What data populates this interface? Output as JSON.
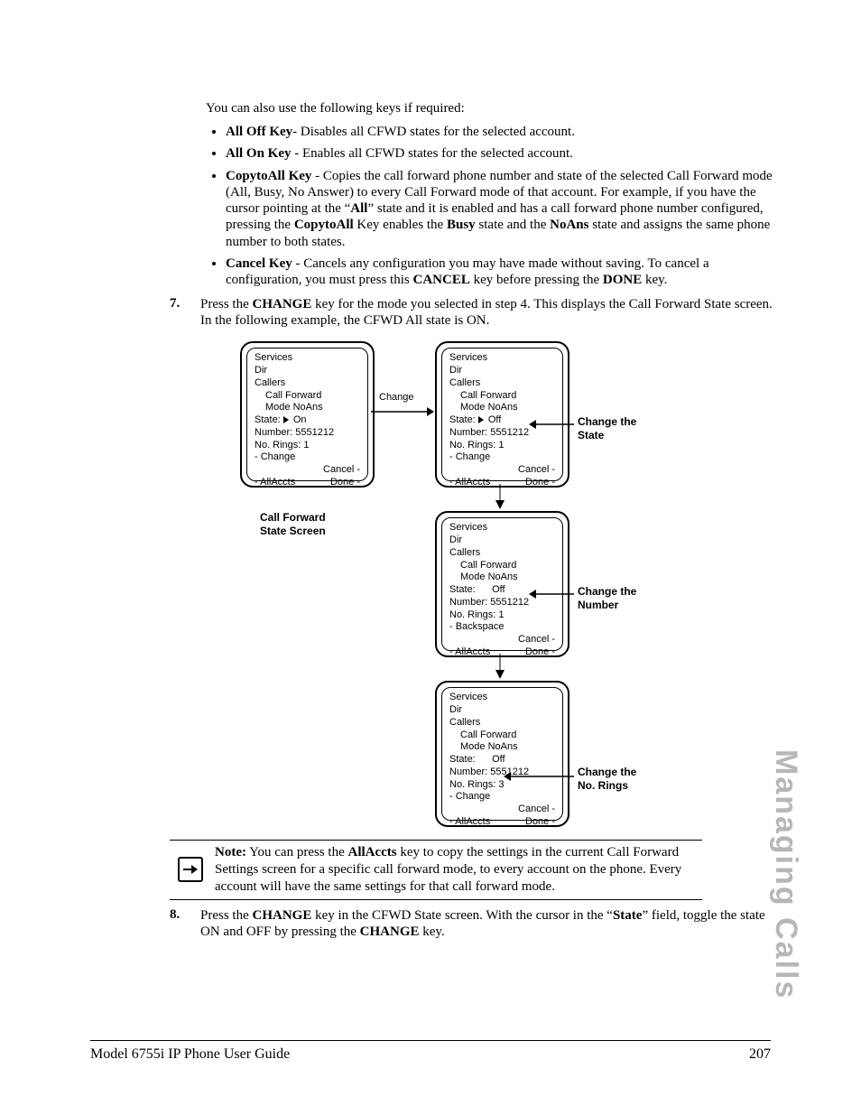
{
  "intro": "You can also use the following keys if required:",
  "bullets": {
    "b1": {
      "key": "All Off Key",
      "sep": "- ",
      "rest": "Disables all CFWD states for the selected account."
    },
    "b2": {
      "key": "All On Key",
      "sep": " - ",
      "rest": "Enables all CFWD states for the selected account."
    },
    "b3": {
      "key": "CopytoAll Key",
      "sep": " - ",
      "p1": "Copies the call forward phone number and state of the selected Call Forward mode (All, Busy, No Answer) to every Call Forward mode of that account. For example, if you have the cursor pointing at the “",
      "all": "All",
      "p2": "” state and it is enabled and has a call forward phone number configured, pressing the ",
      "cta": "CopytoAll",
      "p3": " Key enables the ",
      "busy": "Busy",
      "p4": " state and the ",
      "noans": "NoAns",
      "p5": " state and assigns the same phone number to both states."
    },
    "b4": {
      "key": "Cancel Key",
      "sep": " - ",
      "p1": "Cancels any configuration you may have made without saving. To cancel a configuration, you must press this ",
      "cancel": "CANCEL",
      "p2": " key before pressing the ",
      "done": "DONE",
      "p3": " key."
    }
  },
  "step7": {
    "num": "7.",
    "p1": "Press the ",
    "change": "CHANGE",
    "p2": " key for the mode you selected in step 4. This displays the Call Forward State screen. In the following example, the CFWD All state is ON."
  },
  "diagram": {
    "common": {
      "services": "Services",
      "dir": "Dir",
      "callers": "Callers",
      "cf": "Call Forward",
      "mode": "Mode NoAns"
    },
    "screen1": {
      "state": "State:",
      "stateVal": "On",
      "number": "Number: 5551212",
      "rings": "No. Rings: 1",
      "softL1": "- Change",
      "softR1": "Cancel -",
      "softL2": "- AllAccts",
      "softR2": "Done -"
    },
    "screen2": {
      "state": "State:",
      "stateVal": "Off",
      "number": "Number: 5551212",
      "rings": "No. Rings: 1",
      "softL1": "- Change",
      "softR1": "Cancel -",
      "softL2": "- AllAccts",
      "softR2": "Done -"
    },
    "screen3": {
      "state": "State:      Off",
      "number": "Number: 5551212",
      "rings": "No. Rings: 1",
      "softL1": "- Backspace",
      "softR1": "Cancel -",
      "softL2": "- AllAccts",
      "softR2": "Done -"
    },
    "screen4": {
      "state": "State:      Off",
      "number": "Number: 5551212",
      "rings": "No. Rings: 3",
      "softL1": "- Change",
      "softR1": "Cancel -",
      "softL2": "- AllAccts",
      "softR2": "Done -"
    },
    "labels": {
      "cfss": "Call Forward\nState Screen",
      "change": "Change",
      "chState": "Change the\nState",
      "chNumber": "Change the\nNumber",
      "chRings": "Change the\nNo. Rings"
    }
  },
  "note": {
    "label": "Note:",
    "p1": " You can press the ",
    "allaccts": "AllAccts",
    "p2": " key to copy the settings in the current Call Forward Settings screen for a specific call forward mode, to every account on the phone. Every account will have the same settings for that call forward mode."
  },
  "step8": {
    "num": "8.",
    "p1": "Press the ",
    "change": "CHANGE",
    "p2": " key in the CFWD State screen. With the cursor in the “",
    "state": "State",
    "p3": "” field, toggle the state ON and OFF by pressing the ",
    "change2": "CHANGE",
    "p4": " key."
  },
  "sidebar": "Managing Calls",
  "footer": {
    "left": "Model 6755i IP Phone User Guide",
    "right": "207"
  }
}
